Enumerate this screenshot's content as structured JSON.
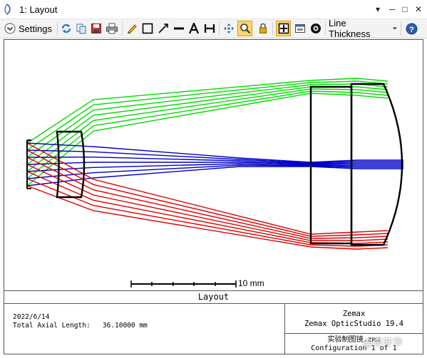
{
  "window": {
    "title": "1: Layout",
    "controls": {
      "minimize": "─",
      "maximize": "□",
      "close": "✕",
      "pin": "▾"
    }
  },
  "toolbar": {
    "settings_label": "Settings",
    "line_thickness_label": "Line Thickness",
    "icons": [
      "settings-chevron-icon",
      "refresh-icon",
      "copy-icon",
      "save-icon",
      "print-icon",
      "pencil-icon",
      "rectangle-icon",
      "arrow-icon",
      "line-icon",
      "text-icon",
      "dimension-icon",
      "pan-icon",
      "zoom-icon",
      "lock-icon",
      "fit-icon",
      "window-icon",
      "camera-icon",
      "help-icon"
    ]
  },
  "colors": {
    "ray_green": "#00dc00",
    "ray_blue": "#0000c8",
    "ray_red": "#e00000",
    "lens": "#000000",
    "accent_active": "#fdd56a"
  },
  "plot": {
    "scale_bar_label": "10 mm",
    "caption": "Layout",
    "date": "2022/6/14",
    "total_axial_length_label": "Total Axial Length:",
    "total_axial_length_value": "36.10000 mm",
    "product_brand": "Zemax",
    "product_name": "Zemax OpticStudio 19.4",
    "file_line": "实验制图镜.zmx",
    "configuration": "Configuration 1 of 1"
  },
  "watermark": "@李开华"
}
